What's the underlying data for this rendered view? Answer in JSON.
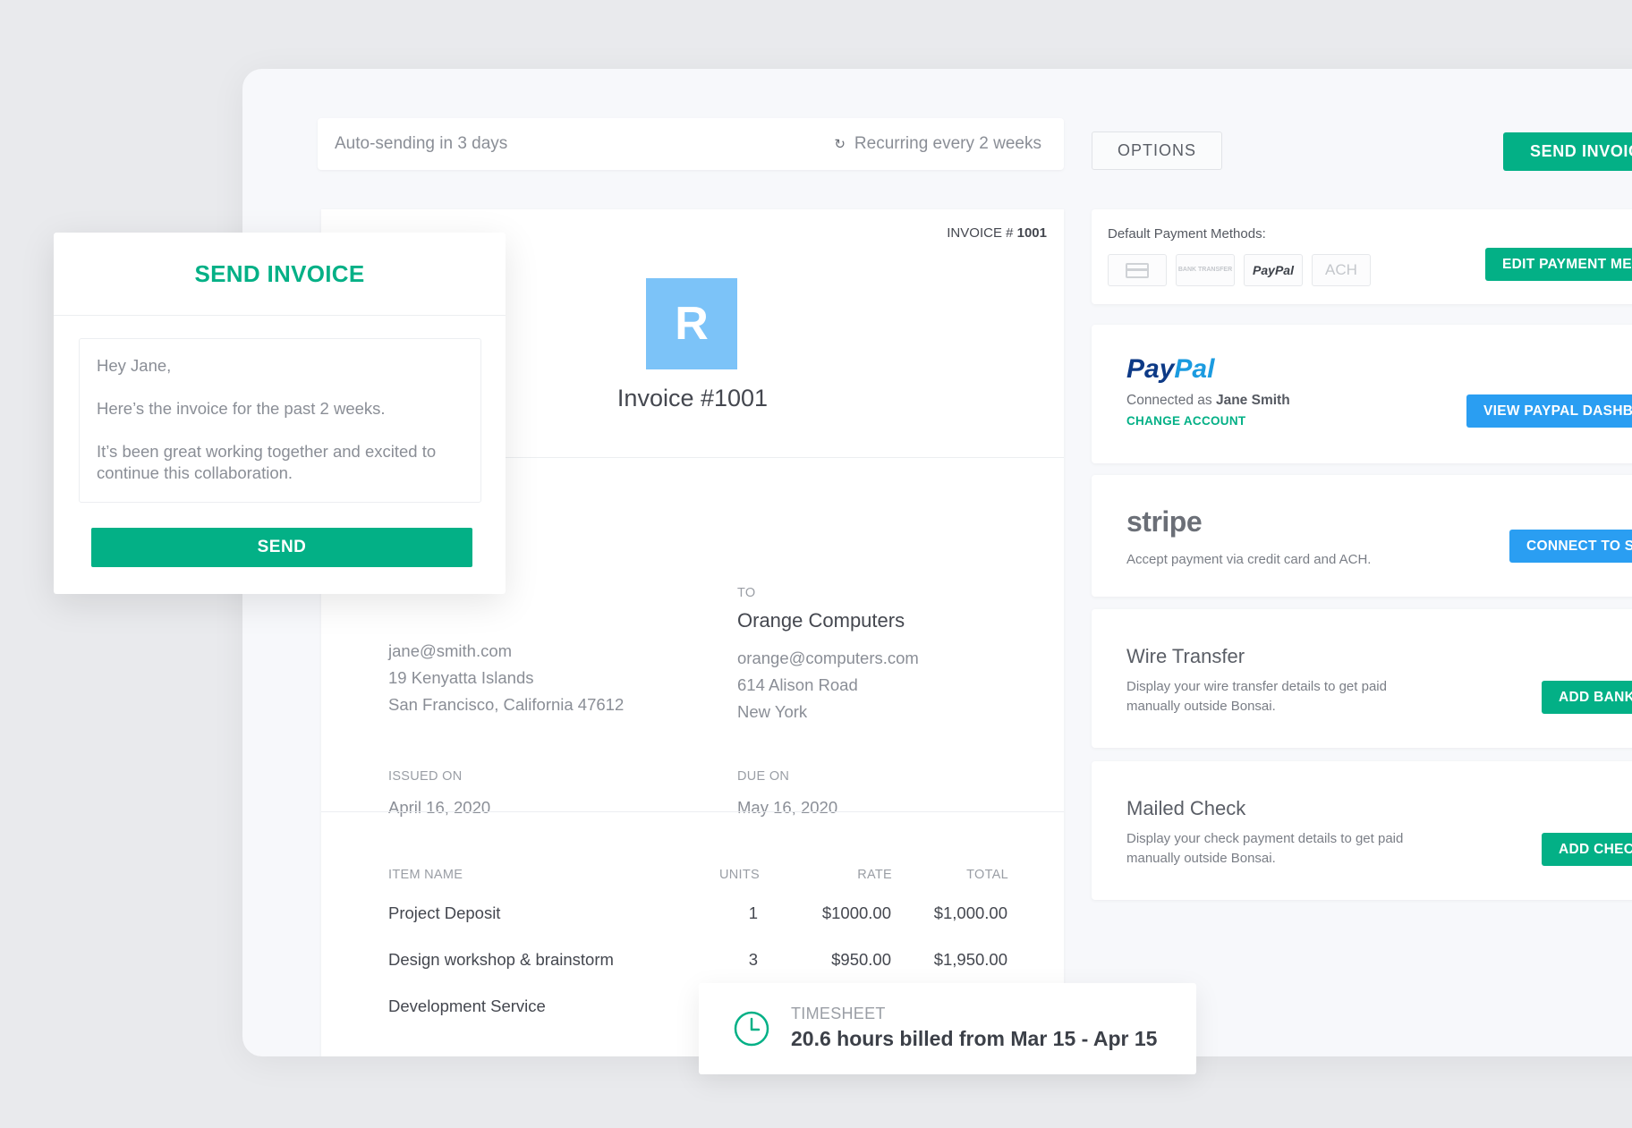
{
  "header": {
    "auto_sending": "Auto-sending in 3 days",
    "recurring": "Recurring every 2 weeks",
    "options_label": "OPTIONS",
    "send_invoice_label": "SEND INVOICE"
  },
  "invoice": {
    "number_prefix": "INVOICE #",
    "number": "1001",
    "logo_letter": "R",
    "title": "Invoice #1001",
    "from": {
      "email": "jane@smith.com",
      "street": "19 Kenyatta Islands",
      "city": "San Francisco, California  47612"
    },
    "to": {
      "label": "TO",
      "name": "Orange Computers",
      "email": "orange@computers.com",
      "street": "614 Alison Road",
      "city": "New York"
    },
    "issued_label": "ISSUED ON",
    "issued_date": "April 16, 2020",
    "due_label": "DUE ON",
    "due_date": "May 16, 2020",
    "columns": {
      "item": "ITEM NAME",
      "units": "UNITS",
      "rate": "RATE",
      "total": "TOTAL"
    },
    "items": [
      {
        "name": "Project Deposit",
        "units": "1",
        "rate": "$1000.00",
        "total": "$1,000.00"
      },
      {
        "name": "Design workshop & brainstorm",
        "units": "3",
        "rate": "$950.00",
        "total": "$1,950.00"
      },
      {
        "name": "Development Service",
        "units": "",
        "rate": "",
        "total": ""
      }
    ]
  },
  "payment": {
    "default_label": "Default Payment Methods:",
    "method_icons": [
      "credit-card-icon",
      "bank-transfer-icon",
      "paypal-icon",
      "ach-icon"
    ],
    "bank_transfer_text": "BANK TRANSFER",
    "paypal_badge": "PayPal",
    "ach_badge": "ACH",
    "edit_label": "EDIT PAYMENT METHODS",
    "paypal": {
      "logo_pay": "Pay",
      "logo_pal": "Pal",
      "connected_prefix": "Connected as",
      "connected_name": "Jane Smith",
      "change_account": "CHANGE ACCOUNT",
      "dashboard_label": "VIEW PAYPAL DASHBOARD"
    },
    "stripe": {
      "logo": "stripe",
      "desc": "Accept payment via credit card and ACH.",
      "connect_label": "CONNECT TO STRIPE"
    },
    "wire": {
      "title": "Wire Transfer",
      "desc": "Display your wire transfer details to get paid manually outside Bonsai.",
      "button": "ADD BANK"
    },
    "check": {
      "title": "Mailed Check",
      "desc": "Display your check payment details to get paid manually outside Bonsai.",
      "button": "ADD CHECK"
    }
  },
  "send_modal": {
    "title": "SEND INVOICE",
    "greeting": "Hey Jane,",
    "line1": "Here’s the invoice for the past 2 weeks.",
    "line2": "It’s been great working together and excited to continue this collaboration.",
    "send_label": "SEND"
  },
  "timesheet": {
    "label": "TIMESHEET",
    "text": "20.6 hours billed from Mar 15 - Apr 15"
  },
  "colors": {
    "brand_green": "#03b086",
    "link_blue": "#2a9ef2",
    "logo_blue": "#7cc3f8",
    "paypal_dark": "#0d3a86",
    "paypal_light": "#1b9be0"
  }
}
